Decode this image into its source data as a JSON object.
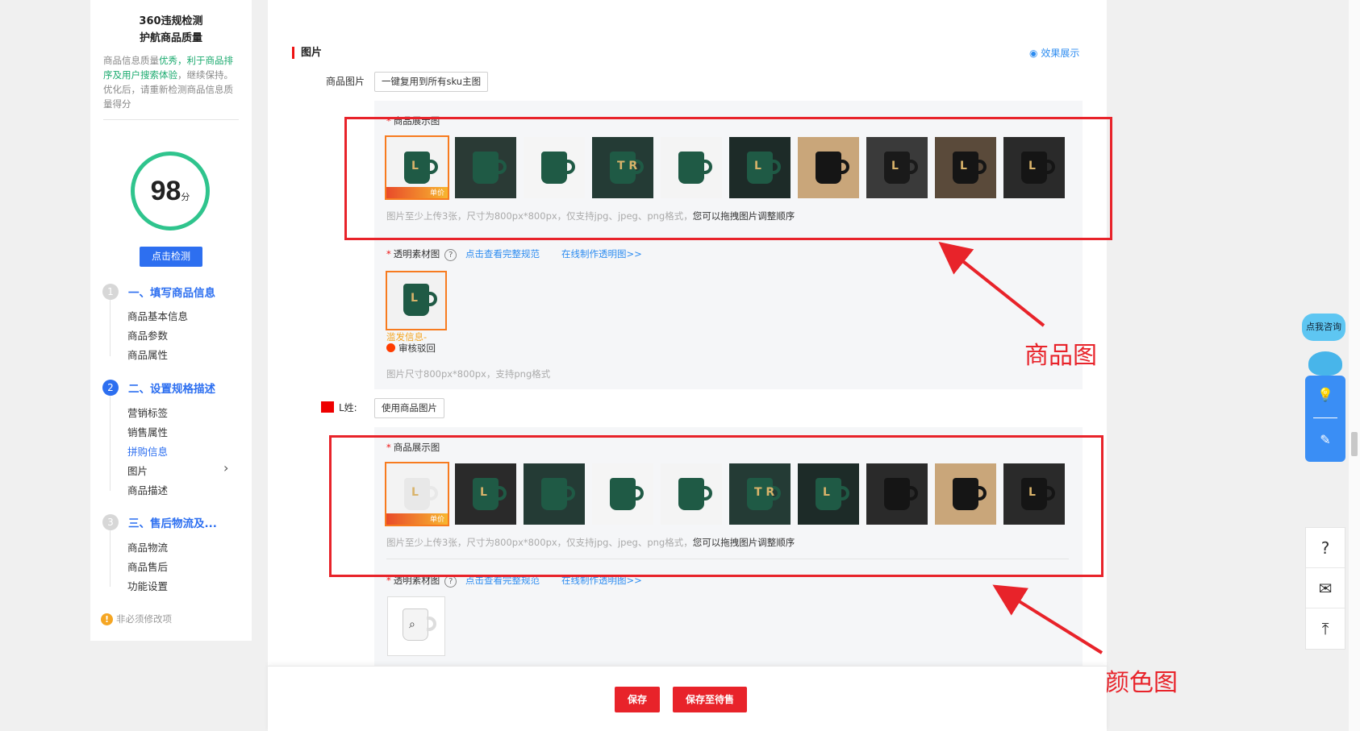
{
  "sidebar": {
    "title_line1": "360违规检测",
    "title_line2": "护航商品质量",
    "desc_part1": "商品信息质量",
    "desc_part2": "优秀，利于商品排序及用户搜索体验",
    "desc_part3": "，继续保持。",
    "desc_part4": "优化后，请重新检测商品信息质量得分",
    "score": "98",
    "score_unit": "分",
    "check_button": "点击检测",
    "steps": [
      {
        "num": "1",
        "label": "一、填写商品信息",
        "items": [
          "商品基本信息",
          "商品参数",
          "商品属性"
        ]
      },
      {
        "num": "2",
        "label": "二、设置规格描述",
        "items": [
          "营销标签",
          "销售属性",
          "拼购信息",
          "图片",
          "商品描述"
        ]
      },
      {
        "num": "3",
        "label": "三、售后物流及...",
        "items": [
          "商品物流",
          "商品售后",
          "功能设置"
        ]
      }
    ],
    "footer_note": "非必须修改项"
  },
  "main": {
    "section_title": "图片",
    "effect_link": "效果展示",
    "product_image_label": "商品图片",
    "reuse_button": "一键复用到所有sku主图",
    "display_image_label": "商品展示图",
    "image_hint_gray": "图片至少上传3张，尺寸为800px*800px，仅支持jpg、jpeg、png格式，",
    "image_hint_dark": "您可以拖拽图片调整顺序",
    "transparent_label": "透明素材图",
    "view_spec_link": "点击查看完整规范",
    "make_online_link": "在线制作透明图>>",
    "pending_text": "滥发信息-",
    "status_text": "审核驳回",
    "transparent_hint": "图片尺寸800px*800px，支持png格式",
    "color_label": "L姓:",
    "use_product_image_button": "使用商品图片",
    "badge_text": "单价",
    "thumb_letters": [
      "L",
      "",
      "",
      "T R",
      "",
      "L",
      "",
      "L",
      "L",
      "L"
    ],
    "thumb_letters_2": [
      "L",
      "L",
      "",
      "",
      "",
      "T R",
      "L",
      "",
      "",
      "L"
    ]
  },
  "annotations": {
    "product_image_note": "商品图",
    "color_image_note": "颜色图"
  },
  "bottom": {
    "save_button": "保存",
    "save_pending_button": "保存至待售"
  },
  "widgets": {
    "consult_label": "点我咨询"
  },
  "colors": {
    "accent_blue": "#2d6ff0",
    "annotation_red": "#e8232a",
    "score_green": "#2fc48d"
  }
}
